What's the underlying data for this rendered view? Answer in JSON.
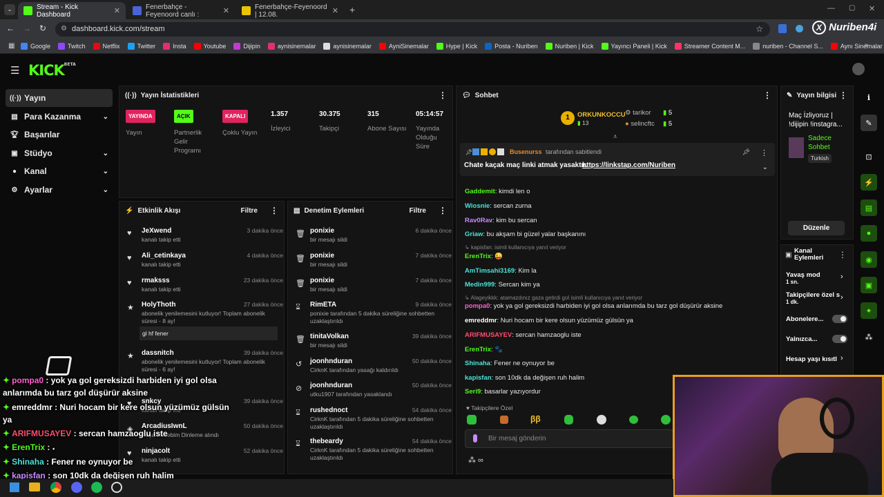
{
  "browser": {
    "tabs": [
      {
        "title": "Stream - Kick Dashboard",
        "color": "#53fc18"
      },
      {
        "title": "Fenerbahçe - Feyenoord canlı :",
        "color": "#4a63d8"
      },
      {
        "title": "Fenerbahçe-Feyenoord | 12.08.",
        "color": "#e9c400"
      }
    ],
    "url": "dashboard.kick.com/stream",
    "bookmarks": [
      {
        "label": "Google",
        "color": "#4285f4"
      },
      {
        "label": "Twitch",
        "color": "#9146ff"
      },
      {
        "label": "Netflix",
        "color": "#e50914"
      },
      {
        "label": "Twitter",
        "color": "#1da1f2"
      },
      {
        "label": "Insta",
        "color": "#e1306c"
      },
      {
        "label": "Youtube",
        "color": "#ff0000"
      },
      {
        "label": "Dijipin",
        "color": "#c23ad1"
      },
      {
        "label": "aynisinemalar",
        "color": "#e1306c"
      },
      {
        "label": "aynisinemalar",
        "color": "#dddddd"
      },
      {
        "label": "AyniSinemalar",
        "color": "#ff0000"
      },
      {
        "label": "Hype | Kick",
        "color": "#53fc18"
      },
      {
        "label": "Posta - Nuriben",
        "color": "#0a66c2"
      },
      {
        "label": "Nuriben | Kick",
        "color": "#53fc18"
      },
      {
        "label": "Yayıncı Paneli | Kick",
        "color": "#53fc18"
      },
      {
        "label": "Streamer Content M...",
        "color": "#ff3366"
      },
      {
        "label": "nuriben - Channel S...",
        "color": "#888888"
      },
      {
        "label": "Aynı Sinemalar - Ça...",
        "color": "#ff0000"
      }
    ],
    "watermark": "Nuriben4i"
  },
  "sidebar": [
    {
      "label": "Yayın",
      "icon": "broadcast-icon"
    },
    {
      "label": "Para Kazanma",
      "icon": "money-icon"
    },
    {
      "label": "Başarılar",
      "icon": "trophy-icon"
    },
    {
      "label": "Stüdyo",
      "icon": "studio-icon"
    },
    {
      "label": "Kanal",
      "icon": "user-icon"
    },
    {
      "label": "Ayarlar",
      "icon": "gear-icon"
    }
  ],
  "stats": {
    "title": "Yayın İstatistikleri",
    "items": [
      {
        "badge": "YAYINDA",
        "badge_color": "#e0245e",
        "label": "Yayın"
      },
      {
        "badge": "AÇIK",
        "badge_color": "#53fc18",
        "label": "Partnerlik Gelir Programı"
      },
      {
        "badge": "KAPALI",
        "badge_color": "#e0245e",
        "label": "Çoklu Yayın"
      },
      {
        "value": "1.357",
        "label": "İzleyici"
      },
      {
        "value": "30.375",
        "label": "Takipçi"
      },
      {
        "value": "315",
        "label": "Abone Sayısı"
      },
      {
        "value": "05:14:57",
        "label": "Yayında Olduğu Süre"
      }
    ]
  },
  "activity": {
    "title": "Etkinlik Akışı",
    "filter": "Filtre",
    "items": [
      {
        "name": "JeXwend",
        "time": "3 dakika önce",
        "sub": "kanalı takip etti"
      },
      {
        "name": "Ali_cetinkaya",
        "time": "4 dakika önce",
        "sub": "kanalı takip etti"
      },
      {
        "name": "rmaksss",
        "time": "23 dakika önce",
        "sub": "kanalı takip etti"
      },
      {
        "name": "HolyThoth",
        "time": "27 dakika önce",
        "sub": "abonelik yenilemesini kutluyor! Toplam abonelik süresi - 8 ay!",
        "note": "gl hf fener"
      },
      {
        "name": "dassnitch",
        "time": "39 dakika önce",
        "sub": "abonelik yenilemesini kutluyor! Toplam abonelik süresi - 6 ay!"
      },
      {
        "name": "snkcy",
        "time": "39 dakika önce",
        "sub": "kanalı takip etti"
      },
      {
        "name": "ArcadiusIwnL",
        "time": "50 dakika önce",
        "sub": "Paşa Recebim Dinleme alındı"
      },
      {
        "name": "ninjacolt",
        "time": "52 dakika önce",
        "sub": "kanalı takip etti"
      }
    ]
  },
  "moderation": {
    "title": "Denetim Eylemleri",
    "filter": "Filtre",
    "items": [
      {
        "name": "ponixie",
        "time": "6 dakika önce",
        "sub": "bir mesajı sildi"
      },
      {
        "name": "ponixie",
        "time": "7 dakika önce",
        "sub": "bir mesajı sildi"
      },
      {
        "name": "ponixie",
        "time": "7 dakika önce",
        "sub": "bir mesajı sildi"
      },
      {
        "name": "RimETA",
        "time": "9 dakika önce",
        "sub": "ponixie tarafından 5 dakika süreliğine sohbetten uzaklaştırıldı"
      },
      {
        "name": "tinitaVolkan",
        "time": "39 dakika önce",
        "sub": "bir mesajı sildi"
      },
      {
        "name": "joonhnduran",
        "time": "50 dakika önce",
        "sub": "CirknK tarafından yasağı kaldırıldı"
      },
      {
        "name": "joonhnduran",
        "time": "50 dakika önce",
        "sub": "utku1907 tarafından yasaklandı"
      },
      {
        "name": "rushednoct",
        "time": "54 dakika önce",
        "sub": "CirknK tarafından 5 dakika süreliğine sohbetten uzaklaştırıldı"
      },
      {
        "name": "thebeardy",
        "time": "54 dakika önce",
        "sub": "CirknK tarafından 5 dakika süreliğine sohbetten uzaklaştırıldı"
      }
    ]
  },
  "chat": {
    "title": "Sohbet",
    "top_gifter": "ORKUNKOCCU",
    "top_gifter_count": "13",
    "gifters": [
      {
        "name": "tarikor",
        "count": "5"
      },
      {
        "name": "selincftc",
        "count": "5"
      }
    ],
    "pinned_by": "Busenurss",
    "pinned_suffix": "tarafından sabitlendi",
    "pinned_text": "Chate kaçak maç linki atmak yasaktır.",
    "pinned_link": "https://linkstap.com/Nuriben",
    "messages": [
      {
        "user": "Gaddemit",
        "color": "#53fc18",
        "text": ": kimdi len o"
      },
      {
        "user": "Wiosnie",
        "color": "#4be3d8",
        "text": ": sercan zurna"
      },
      {
        "user": "Rav0Rav",
        "color": "#c78bff",
        "text": ": kim bu sercan"
      },
      {
        "user": "Griaw",
        "color": "#4be3d8",
        "text": ": bu akşam bi güzel yalar başkanını"
      },
      {
        "reply": "kapisfan:  isimli kullanıcıya yanıt veriyor"
      },
      {
        "user": "ErenTrix",
        "color": "#53fc18",
        "text": ": 😜"
      },
      {
        "user": "AmTimsahi3169",
        "color": "#4be3d8",
        "text": ": Kim la"
      },
      {
        "user": "Medin999",
        "color": "#4be3d8",
        "text": ": Sercan kim ya"
      },
      {
        "reply": "Alageyikkk: atamazdınız gaza getirdi gol isimli kullanıcıya yanıt veriyor"
      },
      {
        "user": "pompa0",
        "color": "#ff5fd2",
        "text": ": yok ya gol gereksizdi harbiden iyi gol olsa anlarımda bu tarz gol düşürür aksine"
      },
      {
        "user": "emreddmr",
        "color": "#ffffff",
        "text": ": Nuri hocam bir kere olsun yüzümüz gülsün ya"
      },
      {
        "user": "ARIFMUSAYEV",
        "color": "#ff4d6d",
        "text": ": sercan hamzaoglu iste"
      },
      {
        "user": "ErenTrix",
        "color": "#53fc18",
        "text": ": 🐾"
      },
      {
        "user": "Shinaha",
        "color": "#4be3d8",
        "text": ": Fener ne oynuyor be"
      },
      {
        "user": "kapisfan",
        "color": "#4be3d8",
        "text": ": son 10dk da değişen ruh halim"
      },
      {
        "user": "Seri9",
        "color": "#53fc18",
        "text": ": basarlar yazıyordur"
      }
    ],
    "followers_only": "Takipçilere Özel",
    "input_placeholder": "Bir mesaj gönderin"
  },
  "info": {
    "title": "Yayın bilgisi",
    "stream_title": "Maç İzliyoruz | !dijipin !instagra...",
    "mode": "Sadece Sohbet",
    "language": "Turkish",
    "edit": "Düzenle"
  },
  "channel_actions": {
    "title": "Kanal Eylemleri",
    "slow_mode": "Yavaş mod",
    "slow_value": "1 sn.",
    "followers": "Takipçilere özel s",
    "followers_value": "1 dk.",
    "subs": "Abonelere...",
    "only": "Yalnızca...",
    "age": "Hesap yaşı kısıtl"
  },
  "overlay": [
    {
      "user": "pompa0",
      "color": "#ff5fd2",
      "text": " : yok ya gol gereksizdi harbiden iyi gol olsa"
    },
    {
      "user": "",
      "color": "#ffffff",
      "text": "anlarımda bu tarz gol düşürür aksine"
    },
    {
      "user": "emreddmr",
      "color": "#ffffff",
      "text": " : Nuri hocam bir kere olsun yüzümüz gülsün"
    },
    {
      "user": "",
      "color": "#ffffff",
      "text": "ya"
    },
    {
      "user": "ARIFMUSAYEV",
      "color": "#ff4d6d",
      "text": " : sercan hamzaoglu iste"
    },
    {
      "user": "ErenTrix",
      "color": "#53fc18",
      "text": " : 𝆹"
    },
    {
      "user": "Shinaha",
      "color": "#4be3d8",
      "text": " : Fener ne oynuyor be"
    },
    {
      "user": "kapisfan",
      "color": "#c78bff",
      "text": " : son 10dk da değişen ruh halim"
    }
  ]
}
